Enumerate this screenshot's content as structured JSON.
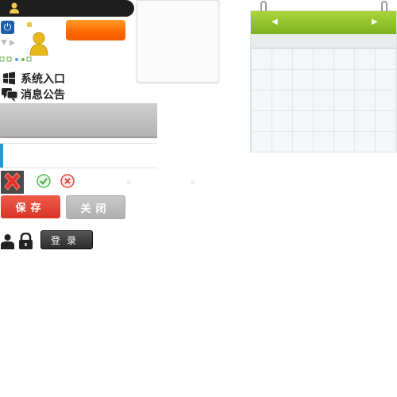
{
  "menu": {
    "items": [
      {
        "label": "系统入口",
        "icon": "windows-icon"
      },
      {
        "label": "消息公告",
        "icon": "chat-bubbles-icon"
      }
    ]
  },
  "actions": {
    "save_label": "保存",
    "close_label": "关闭",
    "login_label": "登录"
  },
  "calendar": {
    "prev_icon": "triangle-left-icon",
    "next_icon": "triangle-right-icon",
    "header_color": "#8cc63f"
  },
  "colors": {
    "primary_orange": "#ff7a00",
    "danger_red": "#e0453a",
    "accent_blue": "#1a9ad7"
  }
}
